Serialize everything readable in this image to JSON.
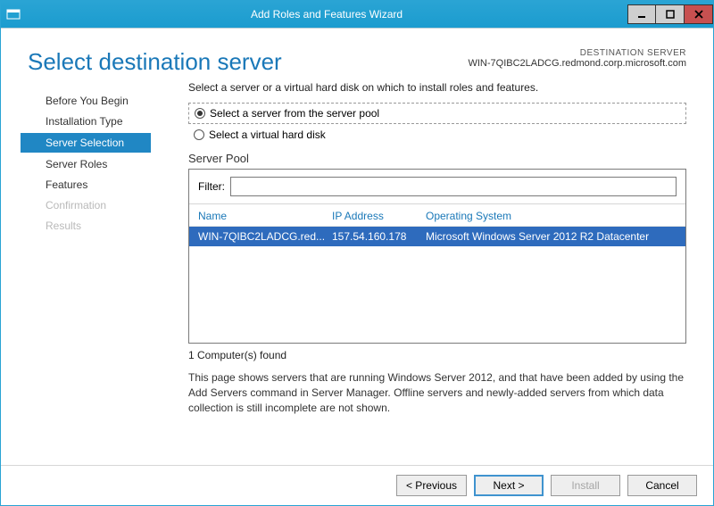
{
  "window": {
    "title": "Add Roles and Features Wizard"
  },
  "header": {
    "page_title": "Select destination server",
    "dest_label": "DESTINATION SERVER",
    "dest_value": "WIN-7QIBC2LADCG.redmond.corp.microsoft.com"
  },
  "nav": {
    "items": [
      {
        "label": "Before You Begin",
        "state": "normal"
      },
      {
        "label": "Installation Type",
        "state": "normal"
      },
      {
        "label": "Server Selection",
        "state": "active"
      },
      {
        "label": "Server Roles",
        "state": "normal"
      },
      {
        "label": "Features",
        "state": "normal"
      },
      {
        "label": "Confirmation",
        "state": "disabled"
      },
      {
        "label": "Results",
        "state": "disabled"
      }
    ]
  },
  "main": {
    "intro": "Select a server or a virtual hard disk on which to install roles and features.",
    "radio1": "Select a server from the server pool",
    "radio2": "Select a virtual hard disk",
    "radio_selected": 0,
    "pool_label": "Server Pool",
    "filter_label": "Filter:",
    "filter_value": "",
    "columns": {
      "name": "Name",
      "ip": "IP Address",
      "os": "Operating System"
    },
    "rows": [
      {
        "name": "WIN-7QIBC2LADCG.red...",
        "ip": "157.54.160.178",
        "os": "Microsoft Windows Server 2012 R2 Datacenter"
      }
    ],
    "count_text": "1 Computer(s) found",
    "note": "This page shows servers that are running Windows Server 2012, and that have been added by using the Add Servers command in Server Manager. Offline servers and newly-added servers from which data collection is still incomplete are not shown."
  },
  "footer": {
    "previous": "< Previous",
    "next": "Next >",
    "install": "Install",
    "cancel": "Cancel"
  }
}
